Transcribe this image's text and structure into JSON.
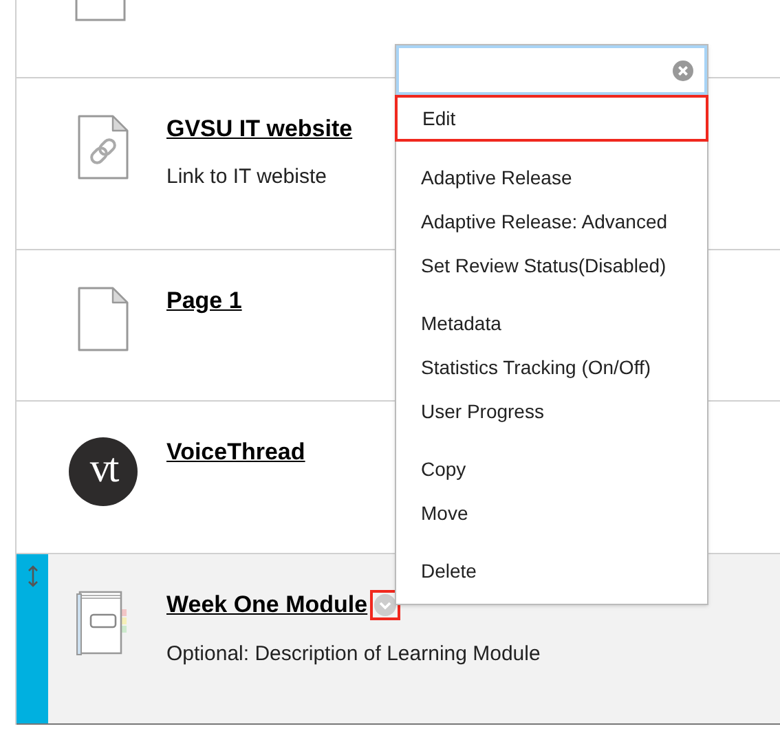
{
  "items": [
    {
      "kind": "cut"
    },
    {
      "kind": "link",
      "title": "GVSU IT website",
      "description": "Link to IT webiste",
      "selected": false
    },
    {
      "kind": "page",
      "title": "Page 1",
      "selected": false
    },
    {
      "kind": "voicethread",
      "title": "VoiceThread",
      "logo_text": "vt",
      "selected": false
    },
    {
      "kind": "module",
      "title": "Week One Module",
      "description": "Optional: Description of Learning Module",
      "selected": true,
      "menu_button": true,
      "menu_button_highlighted": true
    }
  ],
  "menu": {
    "groups": [
      [
        {
          "label": "Edit",
          "highlighted": true
        }
      ],
      [
        {
          "label": "Adaptive Release",
          "highlighted": false
        },
        {
          "label": "Adaptive Release: Advanced",
          "highlighted": false
        },
        {
          "label": "Set Review Status(Disabled)",
          "highlighted": false
        }
      ],
      [
        {
          "label": "Metadata",
          "highlighted": false
        },
        {
          "label": "Statistics Tracking (On/Off)",
          "highlighted": false
        },
        {
          "label": "User Progress",
          "highlighted": false
        }
      ],
      [
        {
          "label": "Copy",
          "highlighted": false
        },
        {
          "label": "Move",
          "highlighted": false
        }
      ],
      [
        {
          "label": "Delete",
          "highlighted": false
        }
      ]
    ]
  }
}
